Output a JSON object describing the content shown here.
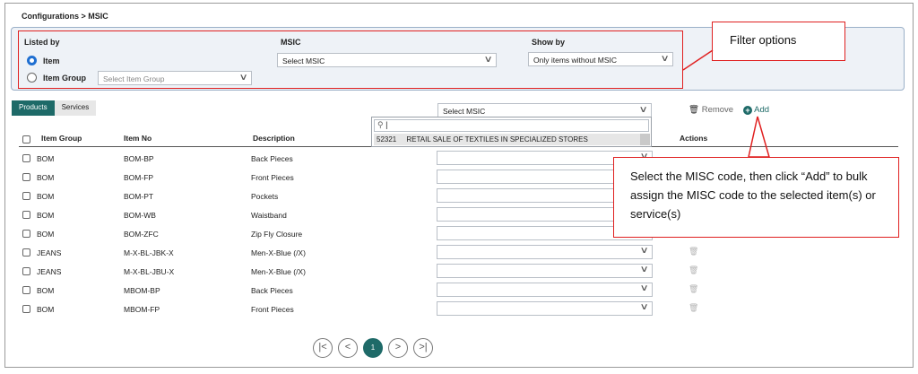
{
  "breadcrumb": "Configurations > MSIC",
  "filters": {
    "listed_by_label": "Listed by",
    "listed_by_options": [
      "Item",
      "Item Group"
    ],
    "item_group_placeholder": "Select Item Group",
    "msic_label": "MSIC",
    "msic_value": "Select MSIC",
    "show_by_label": "Show by",
    "show_by_value": "Only items without MSIC"
  },
  "tabs": [
    "Products",
    "Services"
  ],
  "bulk": {
    "msic_value": "Select MSIC",
    "remove_label": "Remove",
    "add_label": "Add"
  },
  "dropdown": {
    "search_value": "|",
    "option_code": "52321",
    "option_desc": "RETAIL SALE OF TEXTILES IN SPECIALIZED STORES"
  },
  "table": {
    "headers": [
      "Item Group",
      "Item No",
      "Description",
      "Actions"
    ],
    "rows": [
      {
        "group": "BOM",
        "item_no": "BOM-BP",
        "desc": "Back Pieces"
      },
      {
        "group": "BOM",
        "item_no": "BOM-FP",
        "desc": "Front Pieces"
      },
      {
        "group": "BOM",
        "item_no": "BOM-PT",
        "desc": "Pockets"
      },
      {
        "group": "BOM",
        "item_no": "BOM-WB",
        "desc": "Waistband"
      },
      {
        "group": "BOM",
        "item_no": "BOM-ZFC",
        "desc": "Zip Fly Closure"
      },
      {
        "group": "JEANS",
        "item_no": "M-X-BL-JBK-X",
        "desc": "Men-X-Blue (/X)"
      },
      {
        "group": "JEANS",
        "item_no": "M-X-BL-JBU-X",
        "desc": "Men-X-Blue (/X)"
      },
      {
        "group": "BOM",
        "item_no": "MBOM-BP",
        "desc": "Back Pieces"
      },
      {
        "group": "BOM",
        "item_no": "MBOM-FP",
        "desc": "Front Pieces"
      }
    ]
  },
  "pagination": {
    "current_page": "1"
  },
  "annotations": {
    "filter_callout": "Filter options",
    "add_callout": "Select the MISC code, then click “Add” to bulk assign the MISC code to the selected item(s) or service(s)"
  },
  "colors": {
    "accent": "#1e6a68",
    "radio": "#1f6fd1",
    "annotation": "#e02020"
  }
}
